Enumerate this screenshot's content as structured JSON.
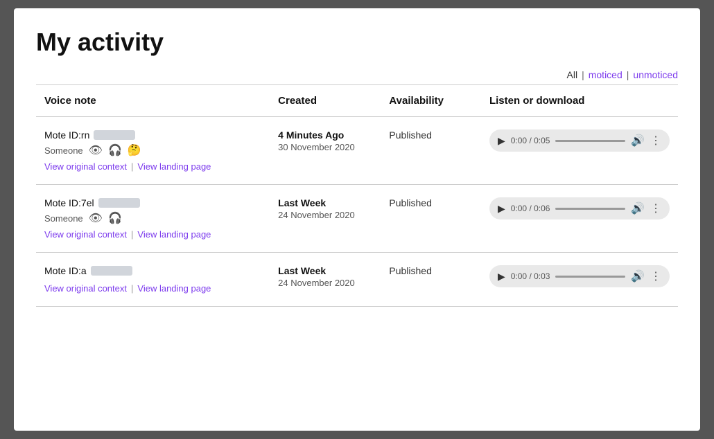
{
  "page": {
    "title": "My activity"
  },
  "filter": {
    "all_label": "All",
    "moticed_label": "moticed",
    "unmoticed_label": "unmoticed",
    "divider": "|"
  },
  "table": {
    "headers": {
      "voice_note": "Voice note",
      "created": "Created",
      "availability": "Availability",
      "listen": "Listen or download"
    },
    "rows": [
      {
        "id_prefix": "Mote ID:rn",
        "someone": "Someone",
        "links": {
          "original": "View original context",
          "landing": "View landing page"
        },
        "icons": [
          "eye",
          "headphones",
          "thinking"
        ],
        "created_relative": "4 Minutes Ago",
        "created_date": "30 November 2020",
        "availability": "Published",
        "audio": {
          "current_time": "0:00",
          "total_time": "0:05"
        }
      },
      {
        "id_prefix": "Mote ID:7el",
        "someone": "Someone",
        "links": {
          "original": "View original context",
          "landing": "View landing page"
        },
        "icons": [
          "eye",
          "headphones"
        ],
        "created_relative": "Last Week",
        "created_date": "24 November 2020",
        "availability": "Published",
        "audio": {
          "current_time": "0:00",
          "total_time": "0:06"
        }
      },
      {
        "id_prefix": "Mote ID:a",
        "someone": null,
        "links": {
          "original": "View original context",
          "landing": "View landing page"
        },
        "icons": [],
        "created_relative": "Last Week",
        "created_date": "24 November 2020",
        "availability": "Published",
        "audio": {
          "current_time": "0:00",
          "total_time": "0:03"
        }
      }
    ]
  }
}
